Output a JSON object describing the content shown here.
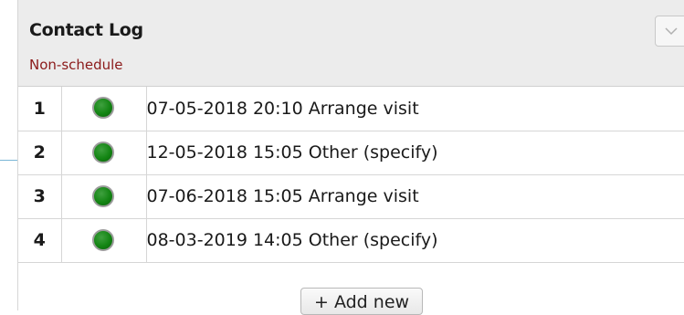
{
  "panel": {
    "title": "Contact Log",
    "subtitle": "Non-schedule",
    "collapse_icon": "chevron-down-icon"
  },
  "entries": [
    {
      "number": "1",
      "status": "green",
      "text": "07-05-2018 20:10 Arrange visit"
    },
    {
      "number": "2",
      "status": "green",
      "text": "12-05-2018 15:05 Other (specify)"
    },
    {
      "number": "3",
      "status": "green",
      "text": "07-06-2018 15:05 Arrange visit"
    },
    {
      "number": "4",
      "status": "green",
      "text": "08-03-2019 14:05 Other (specify)"
    }
  ],
  "footer": {
    "add_label": "+ Add new"
  },
  "colors": {
    "header_bg": "#ececec",
    "subtitle": "#8b1a1a",
    "status_green": "#138513"
  }
}
